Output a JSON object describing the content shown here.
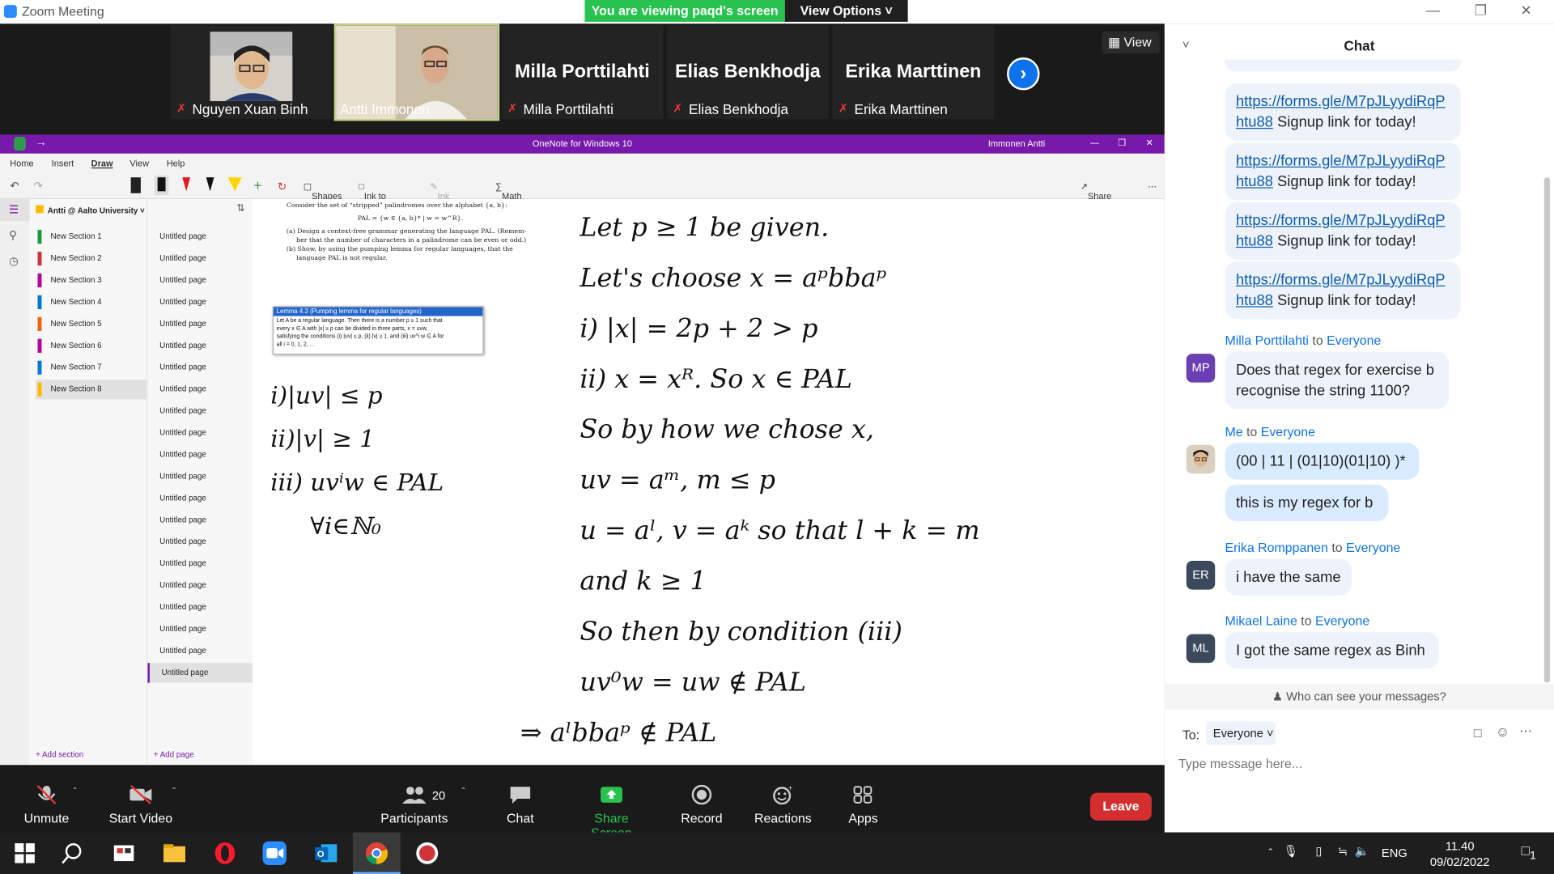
{
  "app": {
    "title": "Zoom Meeting"
  },
  "banner": {
    "viewing": "You are viewing paqd's screen",
    "view_options": "View Options ˅"
  },
  "participants_strip": [
    {
      "name": "Nguyen Xuan Binh"
    },
    {
      "name": "Antti Immonen"
    },
    {
      "name": "Milla Porttilahti",
      "display": "Milla Porttilahti"
    },
    {
      "name": "Elias Benkhodja",
      "display": "Elias Benkhodja"
    },
    {
      "name": "Erika Marttinen",
      "display": "Erika Marttinen"
    }
  ],
  "view_button": "View",
  "onenote": {
    "title": "OneNote for Windows 10",
    "user": "Immonen Antti",
    "tabs": [
      "Home",
      "Insert",
      "Draw",
      "View",
      "Help"
    ],
    "tools": {
      "shapes": "Shapes",
      "ink_to_shape": "Ink to Shape",
      "ink_to_text": "Ink to Text",
      "math": "Math",
      "share": "Share"
    },
    "notebook": "Antti @ Aalto University",
    "sections": [
      {
        "label": "New Section 1",
        "color": "#1e9a3b"
      },
      {
        "label": "New Section 2",
        "color": "#d13438"
      },
      {
        "label": "New Section 3",
        "color": "#b4009e"
      },
      {
        "label": "New Section 4",
        "color": "#0078d4"
      },
      {
        "label": "New Section 5",
        "color": "#f7630c"
      },
      {
        "label": "New Section 6",
        "color": "#b4009e"
      },
      {
        "label": "New Section 7",
        "color": "#0078d4"
      },
      {
        "label": "New Section 8",
        "color": "#ffb900"
      }
    ],
    "page_label": "Untitled page",
    "add_section": "Add section",
    "add_page": "Add page",
    "problem_lines": [
      "Consider the set of “stripped” palindromes over the alphabet {a, b}:",
      "PAL = {w ∈ {a, b}* | w = w^R}.",
      "(a) Design a context-free grammar generating the language PAL. (Remem-",
      "ber that the number of characters in a palindrome can be even or odd.)",
      "(b) Show, by using the pumping lemma for regular languages, that the",
      "language PAL is not regular."
    ],
    "lemma_title": "Lemma 4.3 (Pumping lemma for regular languages)",
    "lemma_lines": [
      "Let A be a regular language. Then there is a number p ≥ 1 such that",
      "every x ∈ A with |x| ≥ p can be divided in three parts, x = uvw,",
      "satisfying the conditions (i) |uv| ≤ p, (ii) |v| ≥ 1, and (iii) uv^i w ∈ A for",
      "all i = 0, 1, 2, …"
    ],
    "ink_left": [
      "i)|uv| ≤ p",
      "ii)|v| ≥ 1",
      "iii) uvⁱw ∈ PAL",
      "∀i∈ℕ₀"
    ],
    "ink_right": [
      "Let p ≥ 1 be given.",
      "Let's choose x = aᵖbbaᵖ",
      "i) |x| = 2p + 2 > p",
      "ii) x = xᴿ. So x ∈ PAL",
      "So by how we chose x,",
      "uv = aᵐ, m ≤ p",
      "u = aˡ, v = aᵏ so that l + k = m",
      "and k ≥ 1",
      "So then by condition (iii)",
      "uv⁰w = uw ∉ PAL",
      "⇒ aˡbbaᵖ ∉ PAL"
    ]
  },
  "toolbar": {
    "unmute": "Unmute",
    "start_video": "Start Video",
    "participants": "Participants",
    "participant_count": "20",
    "chat": "Chat",
    "share_screen": "Share Screen",
    "record": "Record",
    "reactions": "Reactions",
    "apps": "Apps",
    "leave": "Leave"
  },
  "chat": {
    "title": "Chat",
    "link": "https://forms.gle/M7pJLyydiRqPhtu88",
    "link_line1": "https://forms.gle/M7pJLyydiRqP",
    "link_line2": "htu88",
    "link_suffix": " Signup link for today!",
    "messages": [
      {
        "sender": "Milla Porttilahti",
        "to": " to ",
        "target": "Everyone",
        "initials": "MP",
        "color": "#6c3fb5",
        "texts": [
          "Does that regex for exercise b",
          "recognise the string 1100?"
        ]
      },
      {
        "sender": "Me",
        "to": " to ",
        "target": "Everyone",
        "texts": [
          "(00 | 11 |  (01|10)(01|10) )*",
          "this is my regex for b"
        ]
      },
      {
        "sender": "Erika Romppanen",
        "to": " to ",
        "target": "Everyone",
        "initials": "ER",
        "color": "#3a4a5c",
        "texts": [
          "i have the same"
        ]
      },
      {
        "sender": "Mikael Laine",
        "to": " to ",
        "target": "Everyone",
        "initials": "ML",
        "color": "#3a4a5c",
        "texts": [
          "I got the same regex as Binh"
        ]
      }
    ],
    "who_can_see": "Who can see your messages?",
    "to_label": "To:",
    "recipient": "Everyone",
    "placeholder": "Type message here..."
  },
  "taskbar": {
    "lang": "ENG",
    "time": "11.40",
    "date": "09/02/2022",
    "notif": "1"
  }
}
